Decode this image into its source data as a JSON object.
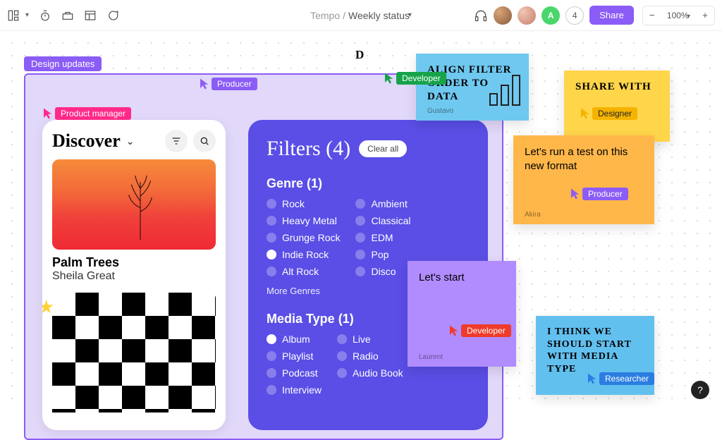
{
  "breadcrumb": {
    "workspace": "Tempo",
    "doc": "Weekly status"
  },
  "topbar": {
    "share_label": "Share",
    "zoom_level": "100%",
    "presence_count": "4",
    "avatar_initial": "A"
  },
  "canvas": {
    "frame_label": "Design updates",
    "d_letter": "D"
  },
  "mobile": {
    "title": "Discover",
    "track_title": "Palm Trees",
    "track_artist": "Sheila Great"
  },
  "filters": {
    "title": "Filters (4)",
    "clear_label": "Clear all",
    "genre_title": "Genre (1)",
    "genre_col1": [
      "Rock",
      "Heavy Metal",
      "Grunge Rock",
      "Indie Rock",
      "Alt Rock"
    ],
    "genre_col2": [
      "Ambient",
      "Classical",
      "EDM",
      "Pop",
      "Disco"
    ],
    "genre_selected_index_col1": 3,
    "more_genres": "More Genres",
    "media_title": "Media Type (1)",
    "media_col1": [
      "Album",
      "Playlist",
      "Podcast",
      "Interview"
    ],
    "media_col2": [
      "Live",
      "Radio",
      "Audio Book"
    ],
    "media_selected_index_col1": 0
  },
  "stickies": {
    "blue": {
      "text": "Align filter order to data",
      "author": "Gustavo"
    },
    "yellow1": {
      "text": "Share with"
    },
    "orange": {
      "text": "Let's run a test on this new format",
      "author": "Akira"
    },
    "purple": {
      "text": "Let's start",
      "author": "Laurent"
    },
    "blue2": {
      "text": "I think we should start with media type"
    }
  },
  "cursors": {
    "product_manager": {
      "label": "Product manager",
      "color": "#ff2a8a"
    },
    "producer": {
      "label": "Producer",
      "color": "#8b5cf6"
    },
    "developer_green": {
      "label": "Developer",
      "color": "#16a34a"
    },
    "developer_red": {
      "label": "Developer",
      "color": "#ef3b2a"
    },
    "designer": {
      "label": "Designer",
      "color": "#f5b301"
    },
    "producer2": {
      "label": "Producer",
      "color": "#8b5cf6"
    },
    "researcher": {
      "label": "Researcher",
      "color": "#2a7de1"
    }
  },
  "help_label": "?"
}
